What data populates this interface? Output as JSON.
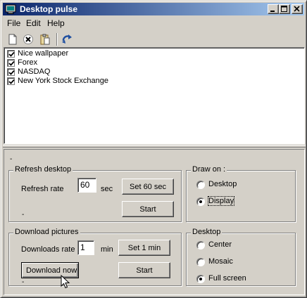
{
  "window": {
    "title": "Desktop pulse",
    "minimize_icon": "minimize-icon",
    "maximize_icon": "maximize-icon",
    "close_icon": "close-icon"
  },
  "menu": {
    "file": "File",
    "edit": "Edit",
    "help": "Help"
  },
  "toolbar": {
    "icons": [
      "new-file-icon",
      "delete-icon",
      "paste-icon",
      "refresh-icon"
    ]
  },
  "list": {
    "items": [
      {
        "label": "Nice wallpaper",
        "checked": true
      },
      {
        "label": "Forex",
        "checked": true
      },
      {
        "label": "NASDAQ",
        "checked": true
      },
      {
        "label": "New York Stock Exchange",
        "checked": true
      }
    ]
  },
  "panel": {
    "dash_top": "-",
    "refresh": {
      "title": "Refresh desktop",
      "rate_label": "Refresh rate",
      "rate_value": "60",
      "unit": "sec",
      "set_button": "Set 60 sec",
      "start_button": "Start",
      "dash": "-"
    },
    "draw_on": {
      "title": "Draw on :",
      "options": [
        {
          "label": "Desktop",
          "selected": false
        },
        {
          "label": "Display",
          "selected": true
        }
      ]
    },
    "download": {
      "title": "Download pictures",
      "rate_label": "Downloads rate",
      "rate_value": "1",
      "unit": "min",
      "set_button": "Set 1 min",
      "download_button": "Download now",
      "start_button": "Start",
      "dash": "-"
    },
    "desktop": {
      "title": "Desktop",
      "options": [
        {
          "label": "Center",
          "selected": false
        },
        {
          "label": "Mosaic",
          "selected": false
        },
        {
          "label": "Full screen",
          "selected": true
        }
      ]
    }
  }
}
